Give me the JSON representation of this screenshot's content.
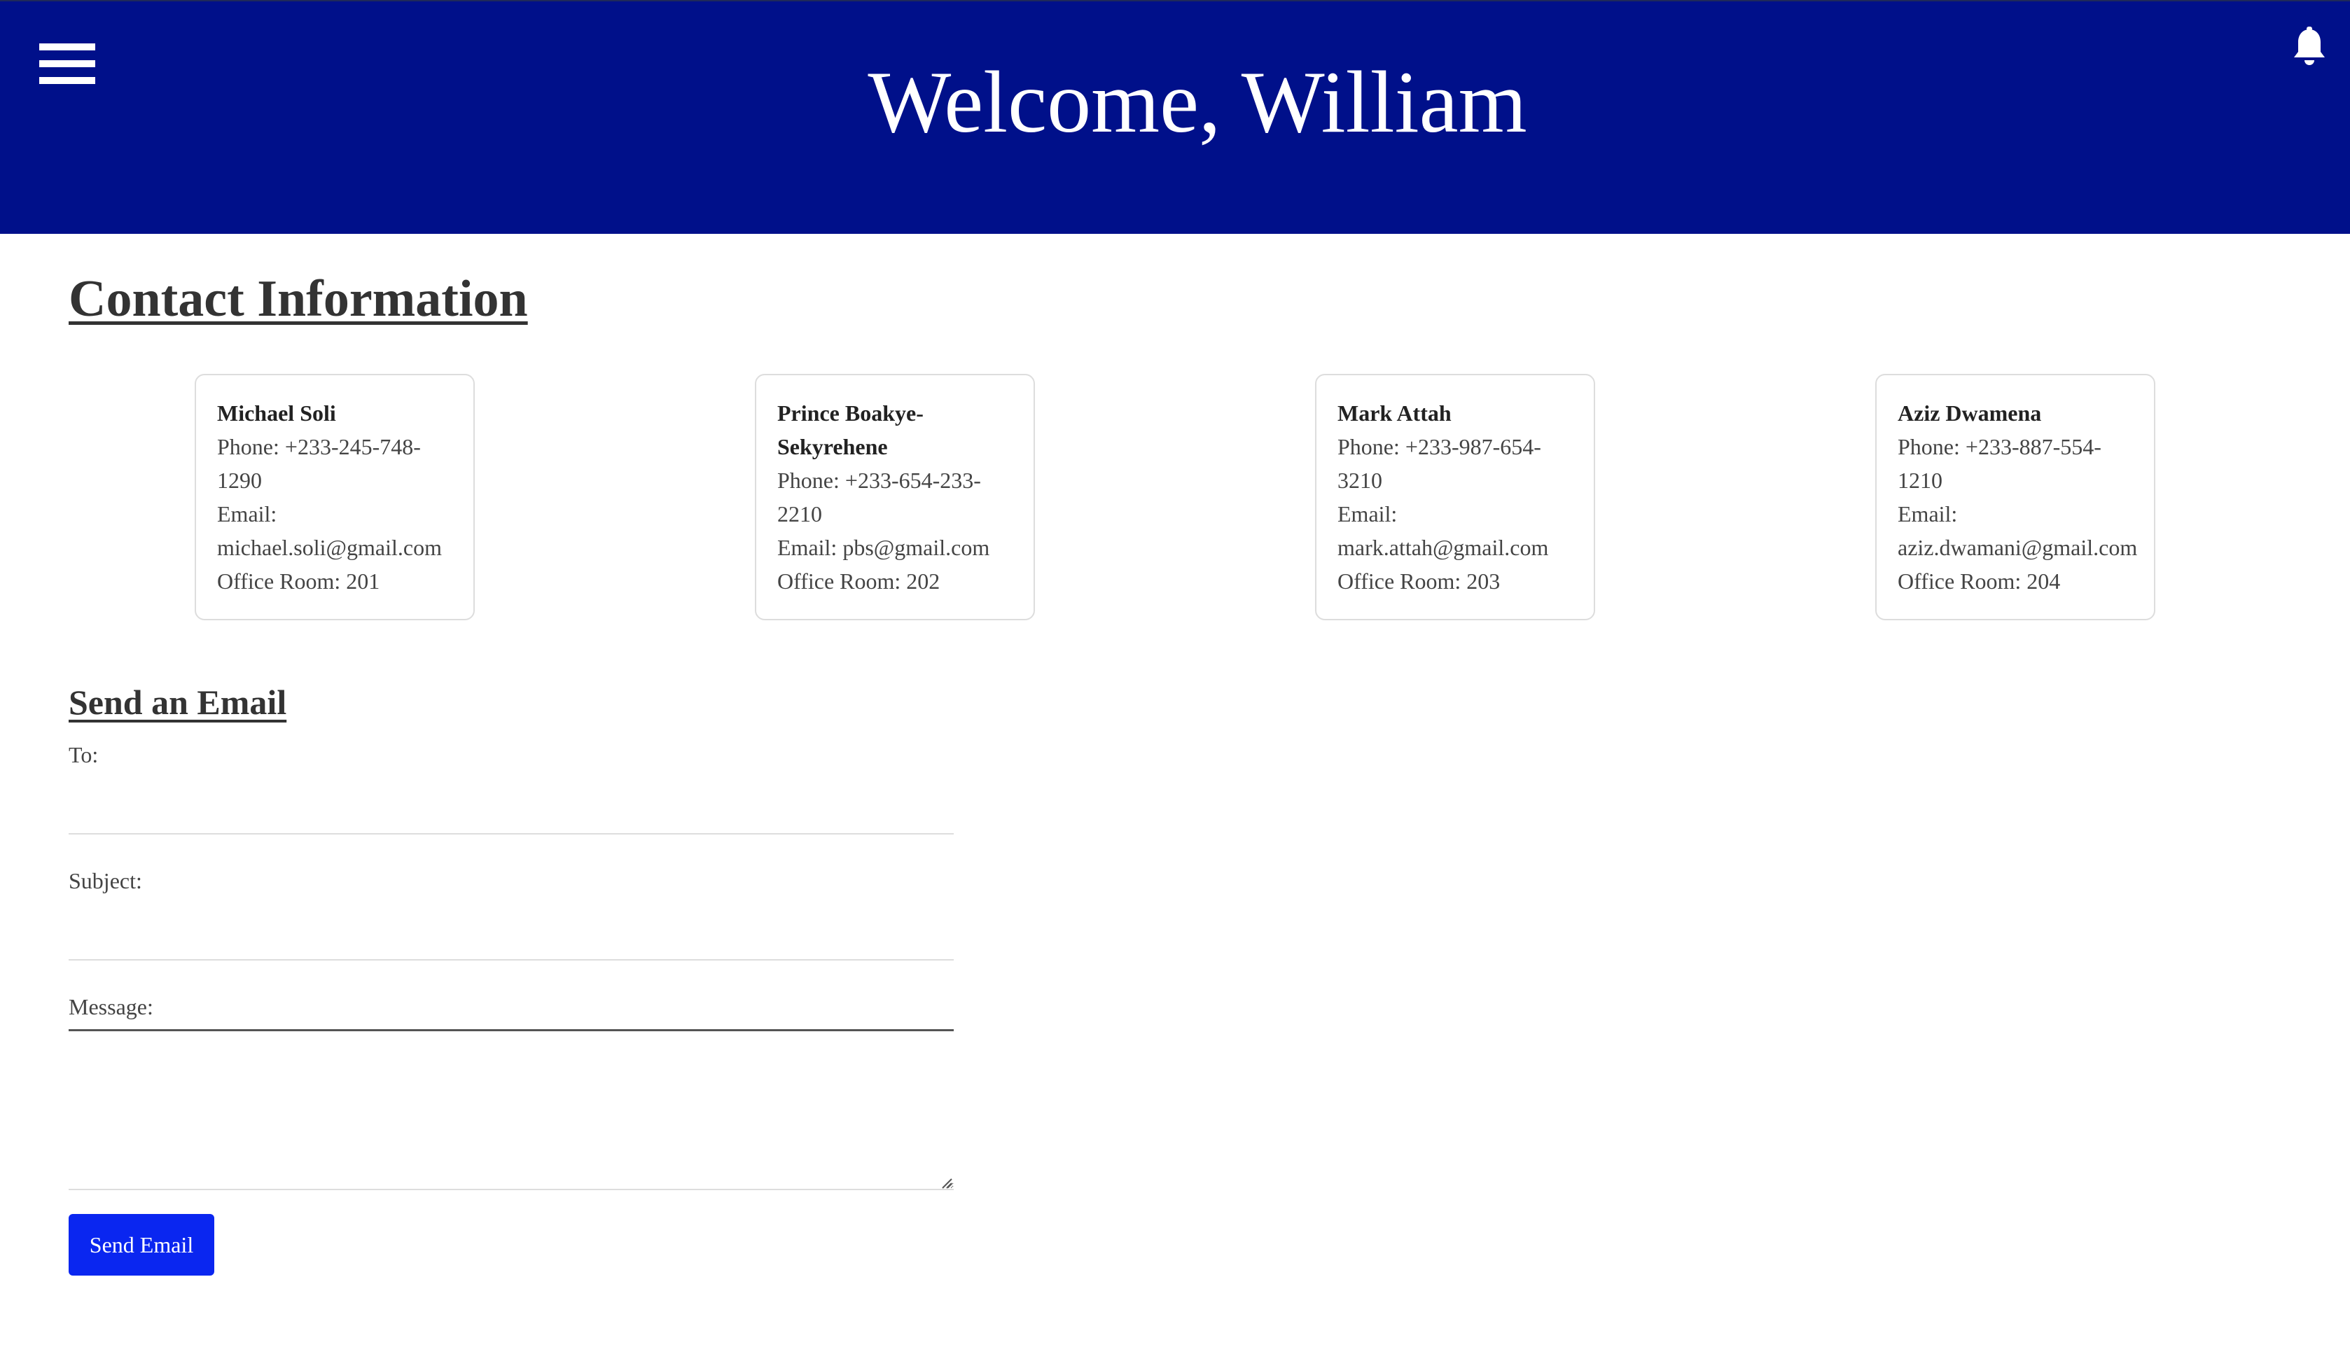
{
  "header": {
    "welcome": "Welcome, William",
    "menu_icon": "hamburger-menu-icon",
    "bell_icon": "bell-icon",
    "background_color": "#00108a"
  },
  "contact_section": {
    "title": "Contact Information",
    "contacts": [
      {
        "name": "Michael Soli",
        "phone": "Phone: +233-245-748-1290",
        "email": "Email: michael.soli@gmail.com",
        "office": "Office Room: 201"
      },
      {
        "name": "Prince Boakye-Sekyrehene",
        "phone": "Phone: +233-654-233-2210",
        "email": "Email: pbs@gmail.com",
        "office": "Office Room: 202"
      },
      {
        "name": "Mark Attah",
        "phone": "Phone: +233-987-654-3210",
        "email": "Email: mark.attah@gmail.com",
        "office": "Office Room: 203"
      },
      {
        "name": "Aziz Dwamena",
        "phone": "Phone: +233-887-554-1210",
        "email": "Email: aziz.dwamani@gmail.com",
        "office": "Office Room: 204"
      }
    ]
  },
  "email_section": {
    "title": "Send an Email",
    "to_label": "To:",
    "to_value": "",
    "subject_label": "Subject:",
    "subject_value": "",
    "message_label": "Message:",
    "message_value": "",
    "send_label": "Send Email",
    "send_color": "#0a26f0"
  }
}
